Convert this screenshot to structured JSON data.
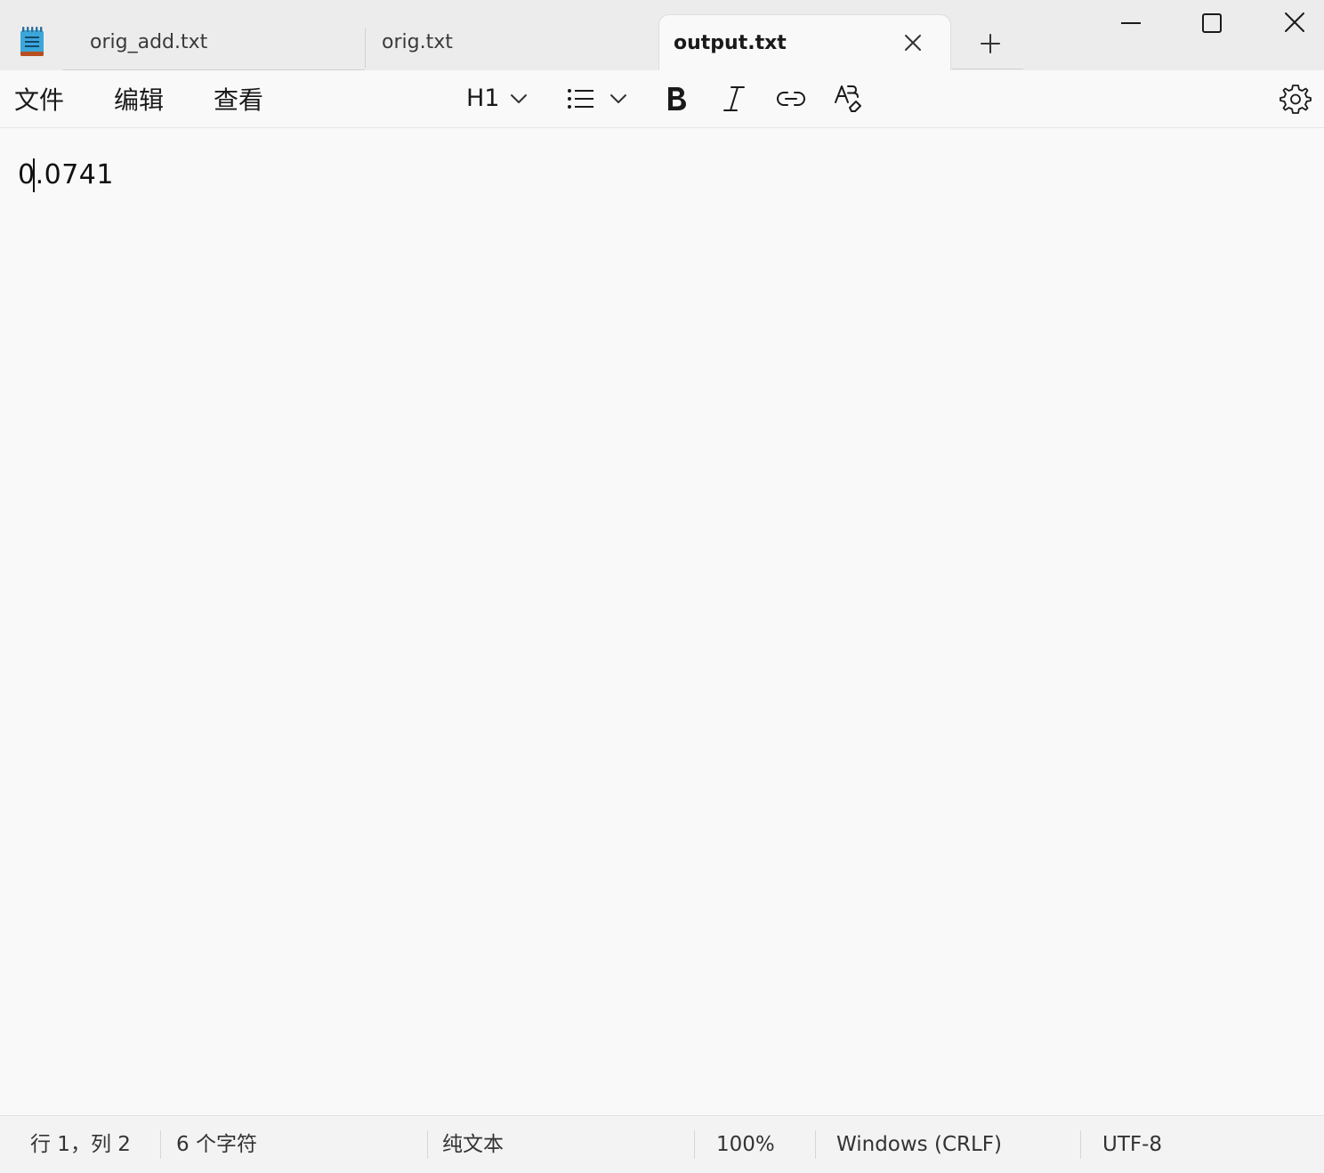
{
  "tabs": [
    {
      "label": "orig_add.txt",
      "active": false
    },
    {
      "label": "orig.txt",
      "active": false
    },
    {
      "label": "output.txt",
      "active": true
    }
  ],
  "menu": {
    "file": "文件",
    "edit": "编辑",
    "view": "查看"
  },
  "toolbar": {
    "heading_label": "H1",
    "icons": [
      "heading-dropdown",
      "list-icon",
      "bold-icon",
      "italic-icon",
      "link-icon",
      "clear-format-icon",
      "gear-icon"
    ]
  },
  "editor": {
    "content": "0.0741"
  },
  "status": {
    "position": "行 1，列 2",
    "char_count": "6 个字符",
    "format": "纯文本",
    "zoom": "100%",
    "line_ending": "Windows (CRLF)",
    "encoding": "UTF-8"
  },
  "colors": {
    "titlebar_bg": "#ececec",
    "editor_bg": "#f9f9f9",
    "statusbar_bg": "#f3f3f3",
    "app_icon_blue": "#3ba7d9"
  }
}
